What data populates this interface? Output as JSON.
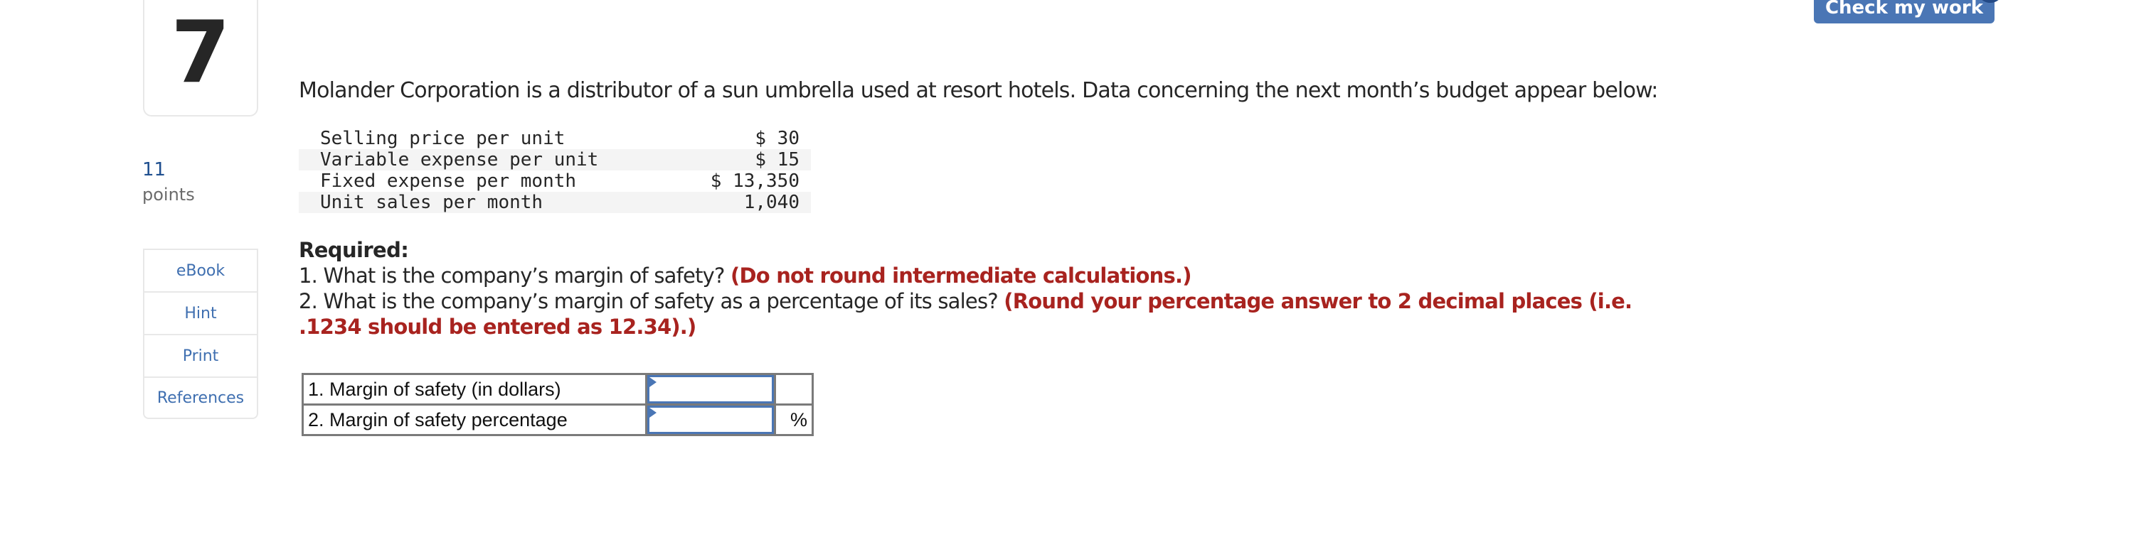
{
  "question": {
    "number": "7",
    "points_value": "11",
    "points_label": "points"
  },
  "tools": [
    {
      "label": "eBook",
      "icon": "none"
    },
    {
      "label": "Hint",
      "icon": "none"
    },
    {
      "label": "Print",
      "icon": "none"
    },
    {
      "label": "References",
      "icon": "none"
    }
  ],
  "header": {
    "check_button_label": "Check my work"
  },
  "problem": {
    "intro": "Molander Corporation is a distributor of a sun umbrella used at resort hotels. Data concerning the next month’s budget appear below:",
    "data_rows": [
      {
        "label": "Selling price per unit",
        "value": "$ 30"
      },
      {
        "label": "Variable expense per unit",
        "value": "$ 15"
      },
      {
        "label": "Fixed expense per month",
        "value": "$ 13,350"
      },
      {
        "label": "Unit sales per month",
        "value": "1,040"
      }
    ],
    "required_title": "Required:",
    "requirements": [
      {
        "text": "1. What is the company’s margin of safety?",
        "note": "(Do not round intermediate calculations.)"
      },
      {
        "text": "2. What is the company’s margin of safety as a percentage of its sales?",
        "note": "(Round your percentage answer to 2 decimal places (i.e.",
        "note_cont": ".1234 should be entered as 12.34).)"
      }
    ]
  },
  "answers": [
    {
      "label": "1. Margin of safety (in dollars)",
      "value": "",
      "suffix": ""
    },
    {
      "label": "2. Margin of safety percentage",
      "value": "",
      "suffix": "%"
    }
  ],
  "colors": {
    "accent_blue": "#4a76b5",
    "badge_blue": "#244a86",
    "note_red": "#a8231f",
    "points_blue": "#1f4f8f"
  }
}
